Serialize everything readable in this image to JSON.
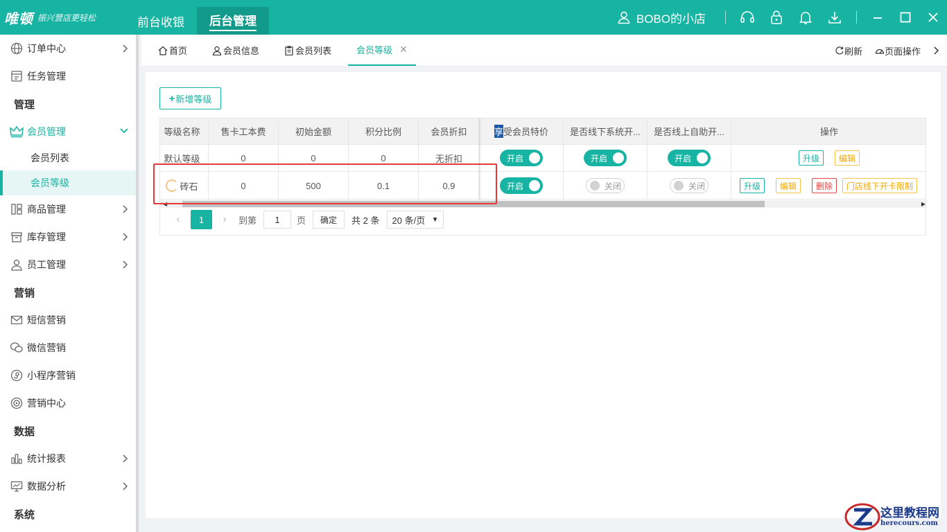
{
  "app": {
    "logo_main": "唯顿",
    "logo_sub": "振兴营店更轻松",
    "top_tabs": [
      "前台收银",
      "后台管理"
    ],
    "store_name": "BOBO的小店"
  },
  "sidebar": {
    "items": [
      {
        "type": "item",
        "label": "订单中心",
        "icon": "globe-icon",
        "arrow": true
      },
      {
        "type": "item",
        "label": "任务管理",
        "icon": "task-icon",
        "arrow": false
      },
      {
        "type": "section",
        "label": "管理"
      },
      {
        "type": "item",
        "label": "会员管理",
        "icon": "crown-icon",
        "arrow": true,
        "open": true
      },
      {
        "type": "sub",
        "label": "会员列表"
      },
      {
        "type": "sub",
        "label": "会员等级",
        "active": true
      },
      {
        "type": "item",
        "label": "商品管理",
        "icon": "goods-icon",
        "arrow": true
      },
      {
        "type": "item",
        "label": "库存管理",
        "icon": "inventory-icon",
        "arrow": true
      },
      {
        "type": "item",
        "label": "员工管理",
        "icon": "staff-icon",
        "arrow": true
      },
      {
        "type": "section",
        "label": "营销"
      },
      {
        "type": "item",
        "label": "短信营销",
        "icon": "sms-icon",
        "arrow": false
      },
      {
        "type": "item",
        "label": "微信营销",
        "icon": "wechat-icon",
        "arrow": false
      },
      {
        "type": "item",
        "label": "小程序营销",
        "icon": "miniprogram-icon",
        "arrow": false
      },
      {
        "type": "item",
        "label": "营销中心",
        "icon": "target-icon",
        "arrow": false
      },
      {
        "type": "section",
        "label": "数据"
      },
      {
        "type": "item",
        "label": "统计报表",
        "icon": "bar-chart-icon",
        "arrow": true
      },
      {
        "type": "item",
        "label": "数据分析",
        "icon": "analysis-icon",
        "arrow": true
      },
      {
        "type": "section",
        "label": "系统"
      }
    ]
  },
  "page_tabs": {
    "tabs": [
      "首页",
      "会员信息",
      "会员列表",
      "会员等级"
    ],
    "refresh": "刷新",
    "page_ops": "页面操作"
  },
  "main": {
    "add_button": "新增等级",
    "add_plus": "+",
    "columns": [
      "等级名称",
      "售卡工本费",
      "初始金额",
      "积分比例",
      "会员折扣",
      "享受会员特价",
      "是否线下系统开...",
      "是否线上自助开...",
      "操作"
    ],
    "rows": [
      {
        "name": "默认等级",
        "fee": "0",
        "initial": "0",
        "points": "0",
        "discount": "无折扣",
        "special": "开启",
        "offline": "开启",
        "online": "开启",
        "actions": [
          "升级",
          "编辑"
        ]
      },
      {
        "name": "砖石",
        "fee": "0",
        "initial": "500",
        "points": "0.1",
        "discount": "0.9",
        "special": "开启",
        "offline": "关闭",
        "online": "关闭",
        "actions": [
          "升级",
          "编辑",
          "删除",
          "门店线下开卡限制"
        ]
      }
    ],
    "pagination": {
      "current": "1",
      "goto_label": "到第",
      "goto_value": "1",
      "page_unit": "页",
      "confirm": "确定",
      "total": "共 2 条",
      "page_size": "20 条/页"
    }
  },
  "watermark": {
    "title": "这里教程网",
    "url": "herecours.com"
  },
  "colors": {
    "accent": "#17b3a3",
    "warning": "#f0a800",
    "danger": "#e24646",
    "annotation": "#e53935"
  }
}
